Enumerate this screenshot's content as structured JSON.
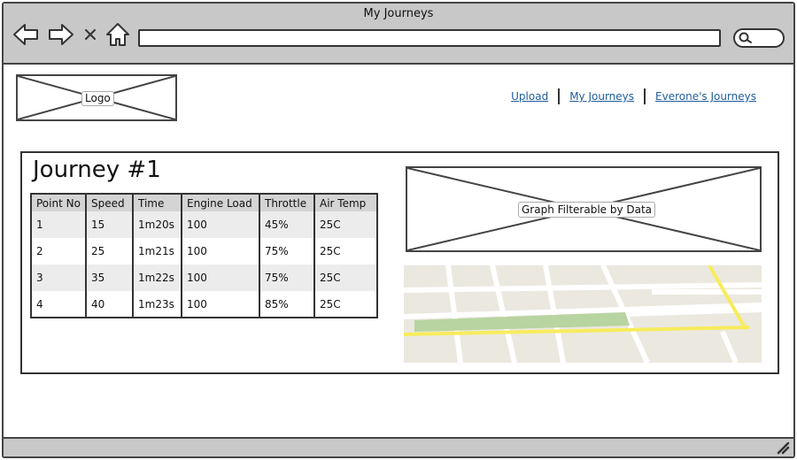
{
  "window": {
    "title": "My Journeys"
  },
  "header": {
    "logo_label": "Logo",
    "nav": [
      {
        "label": "Upload"
      },
      {
        "label": "My Journeys"
      },
      {
        "label": "Everone's Journeys"
      }
    ]
  },
  "main": {
    "journey_title": "Journey #1",
    "table": {
      "columns": [
        "Point No",
        "Speed",
        "Time",
        "Engine Load",
        "Throttle",
        "Air Temp"
      ],
      "rows": [
        [
          "1",
          "15",
          "1m20s",
          "100",
          "45%",
          "25C"
        ],
        [
          "2",
          "25",
          "1m21s",
          "100",
          "75%",
          "25C"
        ],
        [
          "3",
          "35",
          "1m22s",
          "100",
          "75%",
          "25C"
        ],
        [
          "4",
          "40",
          "1m23s",
          "100",
          "85%",
          "25C"
        ]
      ]
    },
    "graph_label": "Graph Filterable by Data"
  },
  "icons": {
    "back": "arrow-left-icon",
    "forward": "arrow-right-icon",
    "stop": "close-icon",
    "home": "home-icon",
    "search": "search-icon",
    "resize": "resize-grip-icon"
  },
  "colors": {
    "chrome": "#c8c8c8",
    "link": "#1f5c9e",
    "map_bg": "#ebe8e0",
    "map_park": "#b8d4a0",
    "map_road_highlight": "#f7ec5c"
  }
}
